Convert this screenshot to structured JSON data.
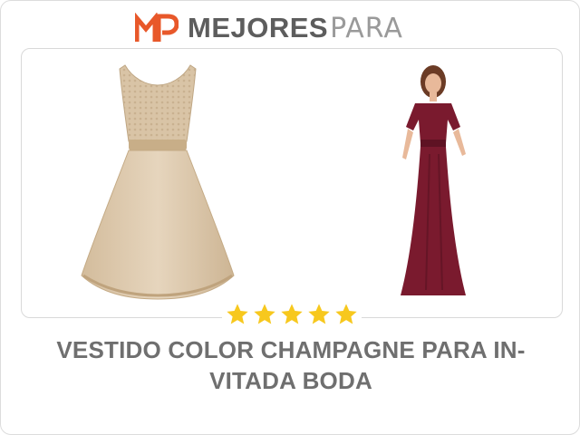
{
  "brand": {
    "logo_text": "MP",
    "name_main": "MEJORES",
    "name_sub": "PARA",
    "accent_color": "#e8582a"
  },
  "product": {
    "rating": {
      "filled": 5,
      "total": 5,
      "star_color": "#f7c81e"
    },
    "title_line1": "VESTIDO COLOR CHAMPAGNE PARA IN-",
    "title_line2": "VITADA BODA",
    "images": [
      {
        "name": "champagne-lace-dress",
        "color": "#dcc7ab"
      },
      {
        "name": "burgundy-long-dress",
        "color": "#7a1a2e"
      }
    ]
  }
}
